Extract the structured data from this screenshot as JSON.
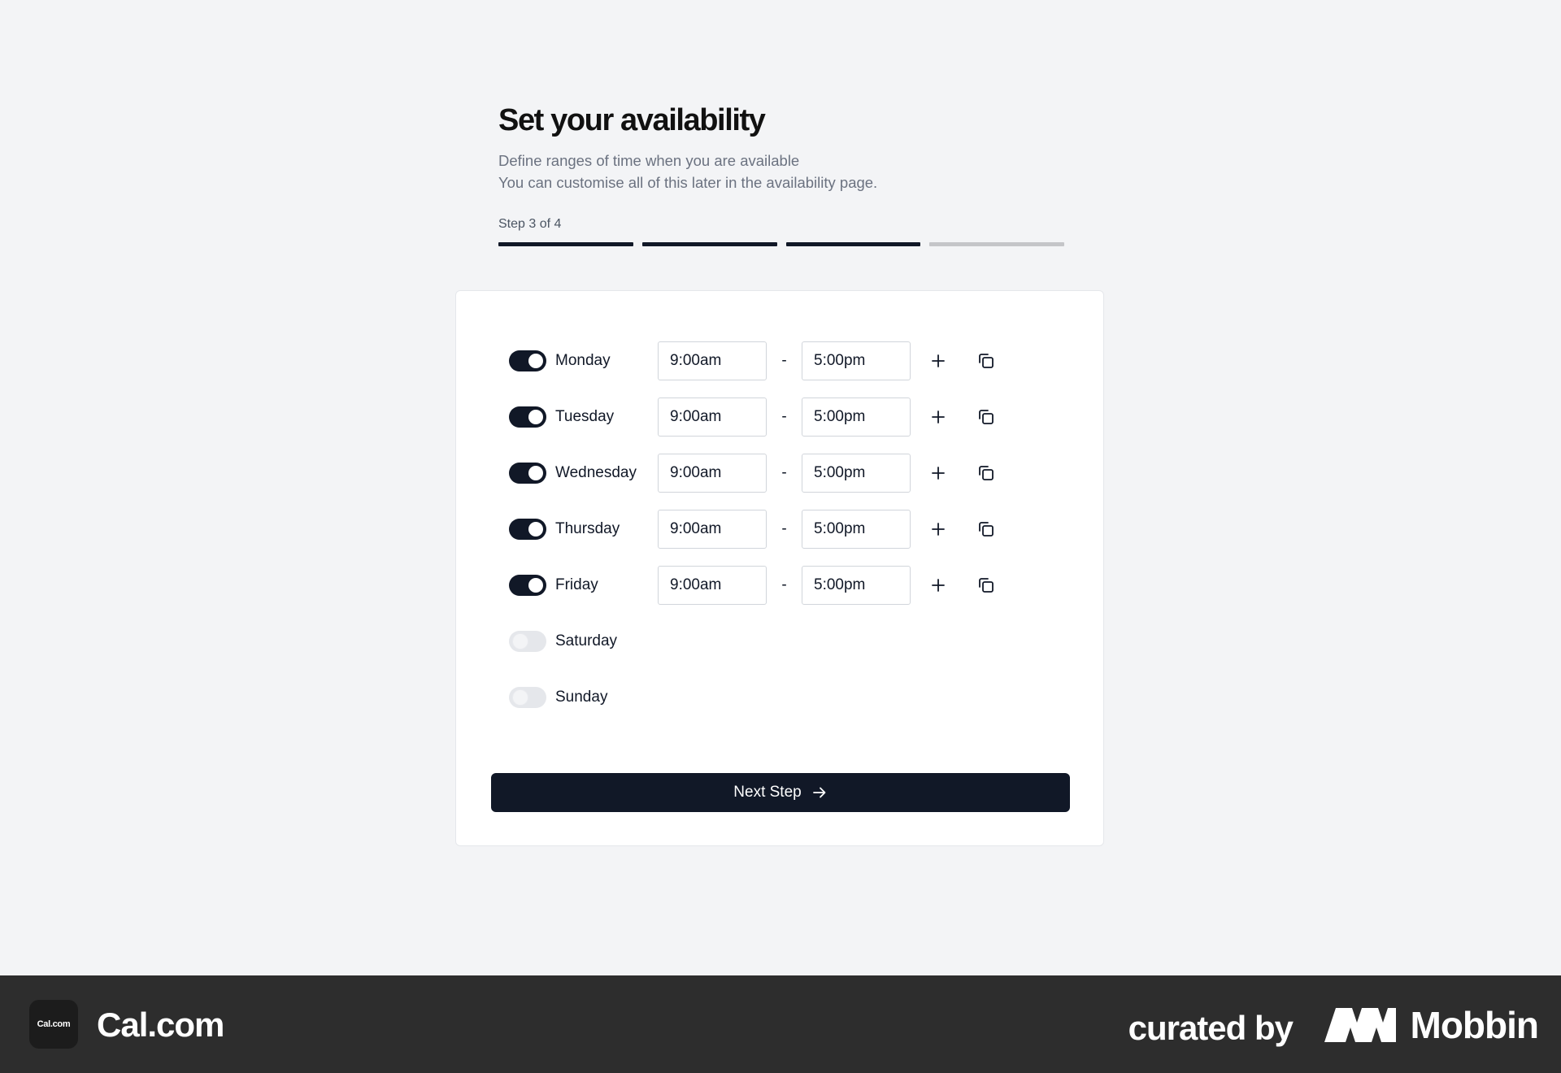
{
  "page": {
    "title": "Set your availability",
    "subtitle_lines": [
      "Define ranges of time when you are available",
      "You can customise all of this later in the availability page."
    ],
    "step_label": "Step 3 of 4",
    "progress": {
      "current_step": 3,
      "total_steps": 4
    }
  },
  "schedule": {
    "days": [
      {
        "name": "Monday",
        "enabled": true,
        "start": "9:00am",
        "end": "5:00pm"
      },
      {
        "name": "Tuesday",
        "enabled": true,
        "start": "9:00am",
        "end": "5:00pm"
      },
      {
        "name": "Wednesday",
        "enabled": true,
        "start": "9:00am",
        "end": "5:00pm"
      },
      {
        "name": "Thursday",
        "enabled": true,
        "start": "9:00am",
        "end": "5:00pm"
      },
      {
        "name": "Friday",
        "enabled": true,
        "start": "9:00am",
        "end": "5:00pm"
      },
      {
        "name": "Saturday",
        "enabled": false
      },
      {
        "name": "Sunday",
        "enabled": false
      }
    ],
    "separator": "-",
    "add_range_icon": "plus-icon",
    "copy_times_icon": "copy-icon"
  },
  "actions": {
    "next_label": "Next Step",
    "next_icon": "arrow-right-icon"
  },
  "footer": {
    "brand_logo_text": "Cal.com",
    "brand_name": "Cal.com",
    "curated_by": "curated by",
    "mobbin": "Mobbin"
  },
  "colors": {
    "primary": "#111827",
    "background": "#f3f4f6",
    "progress_inactive": "#c4c5c8",
    "toggle_off": "#e5e7eb",
    "footer_bg": "#2d2d2d"
  }
}
